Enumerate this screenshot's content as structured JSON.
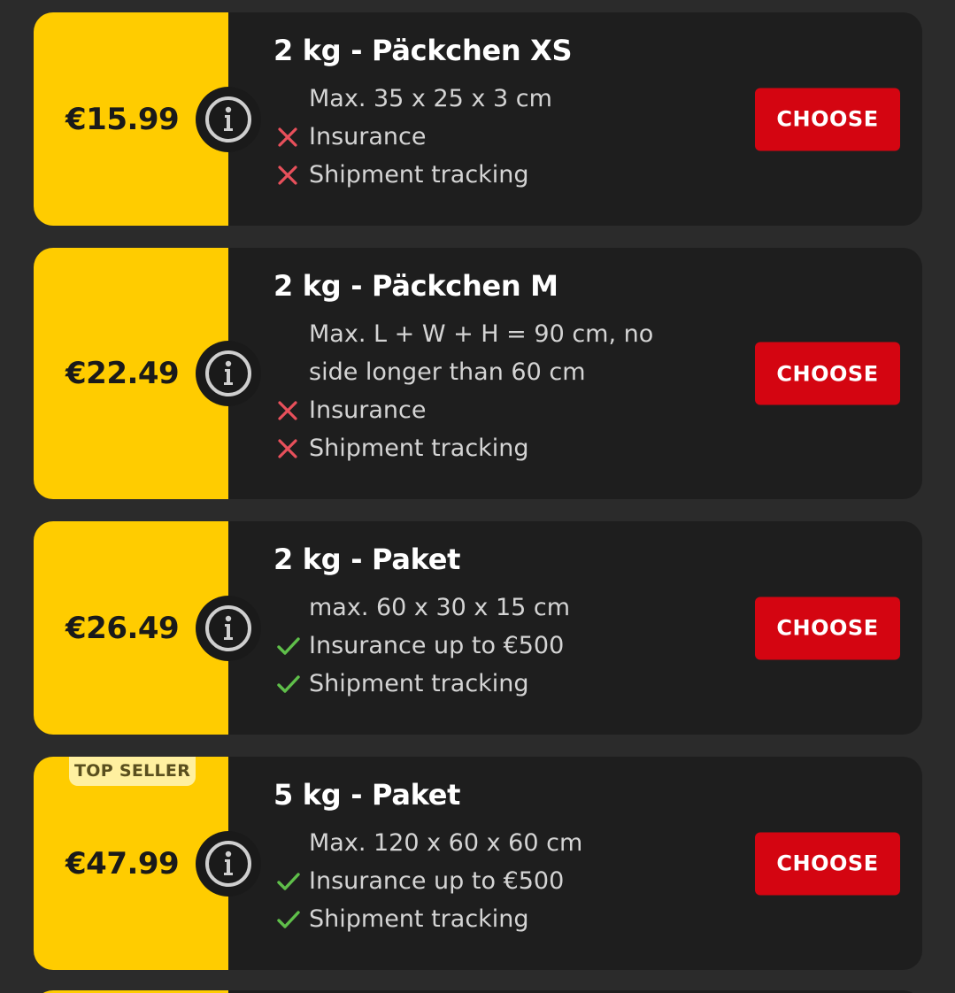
{
  "colors": {
    "price_panel": "#ffcc00",
    "choose_button": "#d40511",
    "card_bg": "#1e1e1e",
    "page_bg": "#2b2b2b",
    "check": "#5fbf4a",
    "cross": "#e8505b"
  },
  "cards": [
    {
      "price": "€15.99",
      "badge": "",
      "title": "2 kg - Päckchen XS",
      "dimensions": "Max. 35 x 25 x 3 cm",
      "features": [
        {
          "icon": "cross-icon",
          "label": "Insurance"
        },
        {
          "icon": "cross-icon",
          "label": "Shipment tracking"
        }
      ],
      "button": "CHOOSE"
    },
    {
      "price": "€22.49",
      "badge": "",
      "title": "2 kg - Päckchen M",
      "dimensions": "Max. L + W + H = 90 cm, no side longer than 60 cm",
      "features": [
        {
          "icon": "cross-icon",
          "label": "Insurance"
        },
        {
          "icon": "cross-icon",
          "label": "Shipment tracking"
        }
      ],
      "button": "CHOOSE"
    },
    {
      "price": "€26.49",
      "badge": "",
      "title": "2 kg - Paket",
      "dimensions": "max. 60 x 30 x 15 cm",
      "features": [
        {
          "icon": "check-icon",
          "label": "Insurance up to €500"
        },
        {
          "icon": "check-icon",
          "label": "Shipment tracking"
        }
      ],
      "button": "CHOOSE"
    },
    {
      "price": "€47.99",
      "badge": "TOP SELLER",
      "title": "5 kg - Paket",
      "dimensions": "Max. 120 x 60 x 60 cm",
      "features": [
        {
          "icon": "check-icon",
          "label": "Insurance up to €500"
        },
        {
          "icon": "check-icon",
          "label": "Shipment tracking"
        }
      ],
      "button": "CHOOSE"
    }
  ]
}
